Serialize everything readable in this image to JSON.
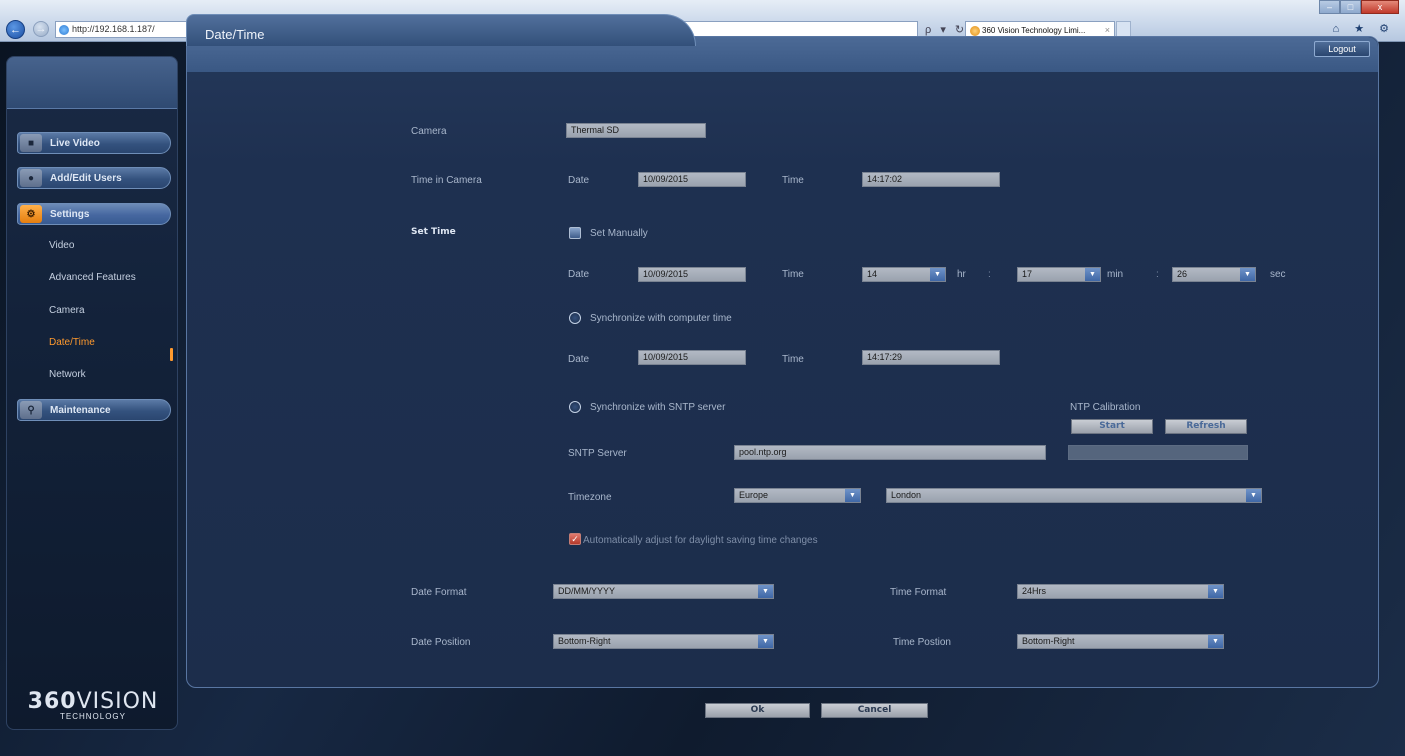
{
  "browser": {
    "url": "http://192.168.1.187/",
    "tab_title": "360 Vision Technology Limi...",
    "tab_close": "×",
    "window_controls": {
      "minimize": "–",
      "maximize": "□",
      "close": "x"
    },
    "search_refresh": "ρ ▾ ↻",
    "tools": "⌂ ★ ⚙"
  },
  "sidebar": {
    "menu": [
      {
        "label": "Live Video",
        "icon": "video-camera-icon"
      },
      {
        "label": "Add/Edit Users",
        "icon": "user-icon"
      },
      {
        "label": "Settings",
        "icon": "settings-icon"
      },
      {
        "label": "Maintenance",
        "icon": "magnifier-icon"
      }
    ],
    "submenu": [
      "Video",
      "Advanced Features",
      "Camera",
      "Date/Time",
      "Network"
    ],
    "active_submenu": "Date/Time",
    "logo": {
      "main_bold": "360",
      "main_thin": "VISION",
      "sub": "TECHNOLOGY"
    }
  },
  "page": {
    "title": "Date/Time",
    "logout_label": "Logout"
  },
  "form": {
    "camera_label": "Camera",
    "camera_value": "Thermal SD",
    "time_in_camera_label": "Time in Camera",
    "date_label": "Date",
    "time_label": "Time",
    "camera_date": "10/09/2015",
    "camera_time": "14:17:02",
    "set_time_label": "Set Time",
    "set_manually_label": "Set Manually",
    "manual_date": "10/09/2015",
    "manual_hr": "14",
    "manual_min": "17",
    "manual_sec": "26",
    "hr_unit": "hr",
    "min_unit": "min",
    "sec_unit": "sec",
    "colon": ":",
    "sync_computer_label": "Synchronize with computer time",
    "computer_date": "10/09/2015",
    "computer_time": "14:17:29",
    "sync_sntp_label": "Synchronize with SNTP server",
    "ntp_calibration_label": "NTP Calibration",
    "start_label": "Start",
    "refresh_label": "Refresh",
    "sntp_server_label": "SNTP Server",
    "sntp_server_value": "pool.ntp.org",
    "timezone_label": "Timezone",
    "timezone_region": "Europe",
    "timezone_city": "London",
    "dst_label": "Automatically adjust for daylight saving time changes",
    "date_format_label": "Date Format",
    "date_format_value": "DD/MM/YYYY",
    "time_format_label": "Time Format",
    "time_format_value": "24Hrs",
    "date_position_label": "Date Position",
    "date_position_value": "Bottom-Right",
    "time_position_label": "Time Postion",
    "time_position_value": "Bottom-Right",
    "ok_label": "Ok",
    "cancel_label": "Cancel"
  },
  "colors": {
    "accent_orange": "#ff9a2e",
    "panel_blue": "#1e3050",
    "select_arrow_blue": "#3f67a6"
  }
}
